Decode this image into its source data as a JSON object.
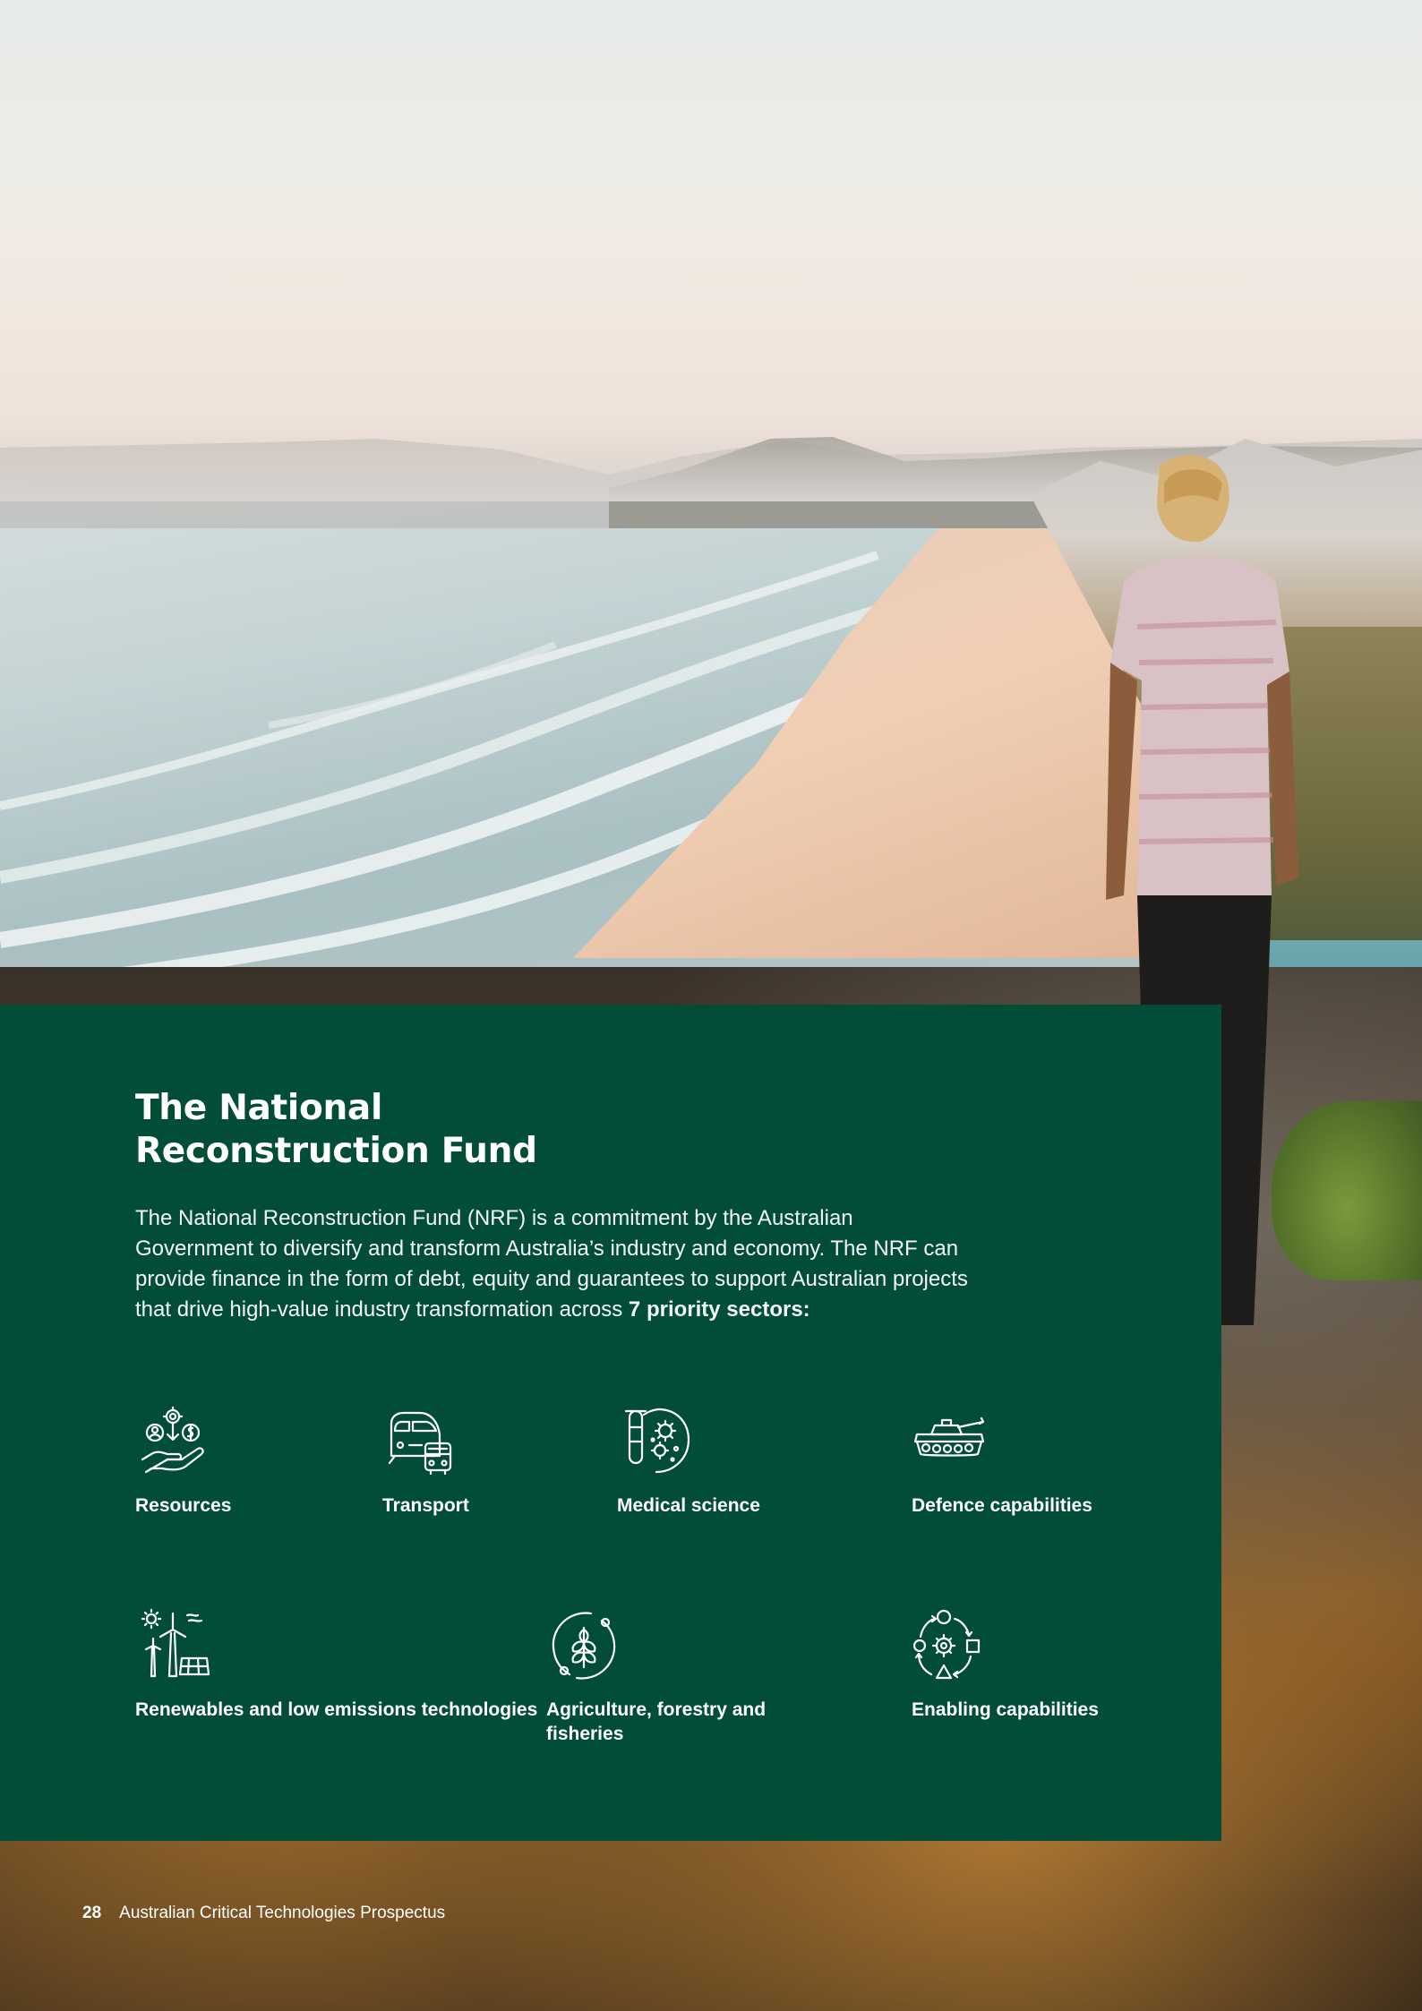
{
  "panel": {
    "title_line1": "The National",
    "title_line2": "Reconstruction Fund",
    "intro_text": "The National Reconstruction Fund (NRF) is a commitment by the Australian Government to diversify and transform Australia’s industry and economy. The NRF can provide finance in the form of debt, equity and guarantees to support Australian projects that drive high-value industry transformation across ",
    "intro_emphasis": "7 priority sectors:"
  },
  "sectors": [
    {
      "label": "Resources",
      "icon": "resources-hand-icon"
    },
    {
      "label": "Transport",
      "icon": "train-bus-icon"
    },
    {
      "label": "Medical science",
      "icon": "virus-testtube-icon"
    },
    {
      "label": "Defence capabilities",
      "icon": "tank-icon"
    },
    {
      "label": "Renewables and low emissions technologies",
      "icon": "wind-solar-icon"
    },
    {
      "label": "Agriculture, forestry and fisheries",
      "icon": "wheat-cycle-icon"
    },
    {
      "label": "Enabling capabilities",
      "icon": "gear-shapes-icon"
    }
  ],
  "footer": {
    "page_number": "28",
    "publication": "Australian Critical Technologies Prospectus"
  },
  "colors": {
    "panel_green": "#024d38",
    "text": "#ffffff"
  }
}
